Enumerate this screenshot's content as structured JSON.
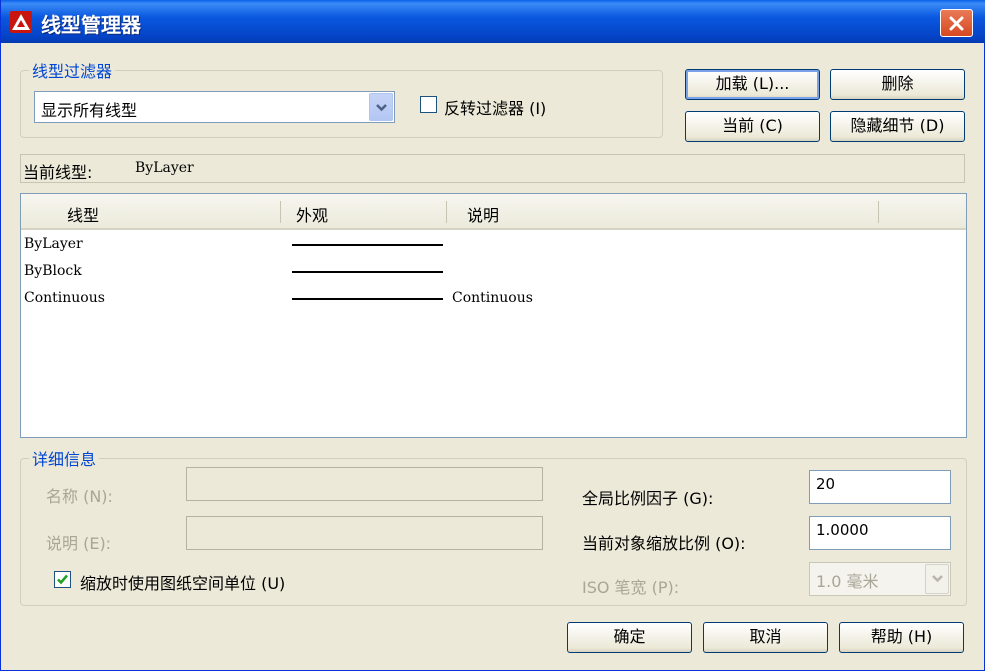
{
  "window": {
    "title": "线型管理器"
  },
  "filter_group": {
    "legend": "线型过滤器",
    "select_value": "显示所有线型",
    "invert_label": "反转过滤器 (I)",
    "invert_checked": false
  },
  "buttons": {
    "load": "加载 (L)...",
    "delete": "删除",
    "current": "当前 (C)",
    "hide_details": "隐藏细节 (D)",
    "ok": "确定",
    "cancel": "取消",
    "help": "帮助 (H)"
  },
  "current_linetype": {
    "label": "当前线型:",
    "value": "ByLayer"
  },
  "linetype_list": {
    "columns": [
      "线型",
      "外观",
      "说明"
    ],
    "rows": [
      {
        "name": "ByLayer",
        "description": ""
      },
      {
        "name": "ByBlock",
        "description": ""
      },
      {
        "name": "Continuous",
        "description": "Continuous"
      }
    ]
  },
  "details": {
    "legend": "详细信息",
    "name_label": "名称 (N):",
    "name_value": "",
    "desc_label": "说明 (E):",
    "desc_value": "",
    "paper_space_label": "缩放时使用图纸空间单位 (U)",
    "paper_space_checked": true,
    "global_scale_label": "全局比例因子 (G):",
    "global_scale_value": "20",
    "object_scale_label": "当前对象缩放比例 (O):",
    "object_scale_value": "1.0000",
    "iso_pen_label": "ISO 笔宽 (P):",
    "iso_pen_value": "1.0 毫米"
  },
  "colors": {
    "title_bar": "#0a58e0",
    "close_button": "#d64820",
    "group_legend": "#0046d5",
    "window_bg": "#ece9d8"
  }
}
